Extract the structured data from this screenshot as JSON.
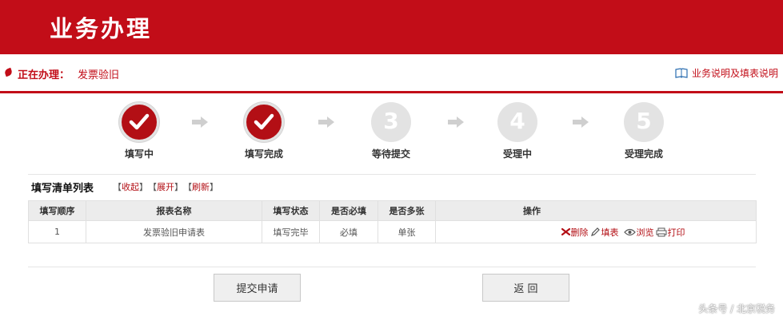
{
  "header": {
    "title": "业务办理"
  },
  "status": {
    "label": "正在办理：",
    "value": "发票验旧",
    "help_link": "业务说明及填表说明"
  },
  "steps": [
    {
      "label": "填写中",
      "state": "done"
    },
    {
      "label": "填写完成",
      "state": "done"
    },
    {
      "label": "等待提交",
      "state": "todo",
      "number": "3"
    },
    {
      "label": "受理中",
      "state": "todo",
      "number": "4"
    },
    {
      "label": "受理完成",
      "state": "todo",
      "number": "5"
    }
  ],
  "list": {
    "title": "填写清单列表",
    "tools": [
      "收起",
      "展开",
      "刷新"
    ],
    "columns": [
      "填写顺序",
      "报表名称",
      "填写状态",
      "是否必填",
      "是否多张",
      "操作"
    ],
    "rows": [
      {
        "order": "1",
        "name": "发票验旧申请表",
        "status": "填写完毕",
        "required": "必填",
        "multiple": "单张"
      }
    ],
    "actions": [
      {
        "label": "删除",
        "icon": "delete-icon"
      },
      {
        "label": "填表",
        "icon": "pencil-icon"
      },
      {
        "label": "浏览",
        "icon": "eye-icon"
      },
      {
        "label": "打印",
        "icon": "printer-icon"
      }
    ]
  },
  "buttons": {
    "submit": "提交申请",
    "back": "返 回"
  },
  "watermark": "头条号 / 北京税务",
  "colors": {
    "brand_red": "#c20d18",
    "step_done": "#b30f15",
    "step_todo": "#e3e3e3"
  }
}
